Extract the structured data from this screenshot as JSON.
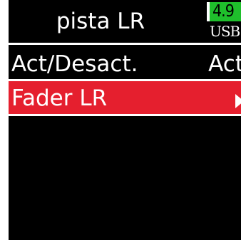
{
  "header": {
    "title": "pista LR",
    "battery_level": "4.9",
    "power_source": "USB",
    "battery_color": "#1fbf2c"
  },
  "menu": {
    "items": [
      {
        "label": "Act/Desact.",
        "value": "Act"
      },
      {
        "label": "Fader LR",
        "value": "",
        "icon": "arrow-right-icon"
      }
    ],
    "selected_index": 1,
    "selection_color": "#e51f2e"
  }
}
